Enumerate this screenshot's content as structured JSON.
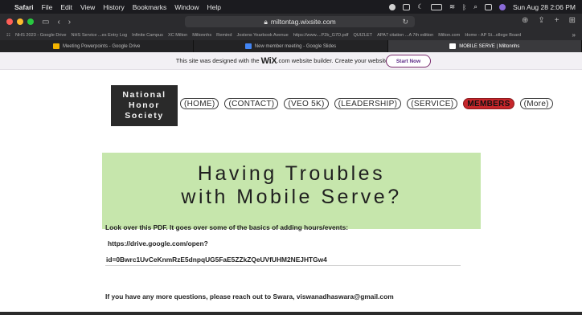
{
  "menubar": {
    "app": "Safari",
    "menus": [
      "File",
      "Edit",
      "View",
      "History",
      "Bookmarks",
      "Window",
      "Help"
    ],
    "clock": "Sun Aug 28 2:06 PM"
  },
  "toolbar": {
    "url": "miltontag.wixsite.com"
  },
  "favorites": [
    "NHS 2023 - Google Drive",
    "NHS Service ...es Entry Log",
    "Infinite Campus",
    "XC Milton",
    "Miltonnhs",
    "Remind",
    "Jostens Yearbook Avenue",
    "https://www....P2b_G7D.pdf",
    "QUIZLET",
    "APA7 citation ...A 7th edition",
    "Milton.com",
    "Home - AP St...ollege Board"
  ],
  "tabs": [
    {
      "label": "Meeting Powerpoints - Google Drive",
      "active": false,
      "icon_color": "#f4b400"
    },
    {
      "label": "New member meeting - Google Slides",
      "active": false,
      "icon_color": "#4285f4"
    },
    {
      "label": "MOBILE SERVE | Miltonnhs",
      "active": true,
      "icon_color": "#ffffff"
    }
  ],
  "wix_banner": {
    "prefix": "This site was designed with the",
    "brand": "WiX",
    "suffix": ".com website builder. Create your website today.",
    "button": "Start Now"
  },
  "logo": {
    "line1": "National",
    "line2": "Honor",
    "line3": "Society"
  },
  "nav": [
    {
      "label": "HOME",
      "active": false
    },
    {
      "label": "CONTACT",
      "active": false
    },
    {
      "label": "VEO 5K",
      "active": false
    },
    {
      "label": "LEADERSHIP",
      "active": false
    },
    {
      "label": "SERVICE",
      "active": false
    },
    {
      "label": "MEMBERS",
      "active": true
    },
    {
      "label": "More",
      "active": false
    }
  ],
  "banner": {
    "line1": "Having Troubles",
    "line2": "with Mobile Serve?"
  },
  "content": {
    "intro": "Look over this PDF. It goes over some of the basics of adding hours/events:",
    "link_part1": "https://drive.google.com/open?",
    "link_part2": "id=0Bwrc1UvCeKnmRzE5dnpqUG5FaE5ZZkZQeUVfUHM2NEJHTGw4",
    "contact": "If you have any more questions, please reach out to Swara, viswanadhaswara@gmail.com"
  },
  "colors": {
    "banner_bg": "#c6e6ac",
    "members_active": "#c6262b",
    "logo_bg": "#2a2a2a"
  }
}
